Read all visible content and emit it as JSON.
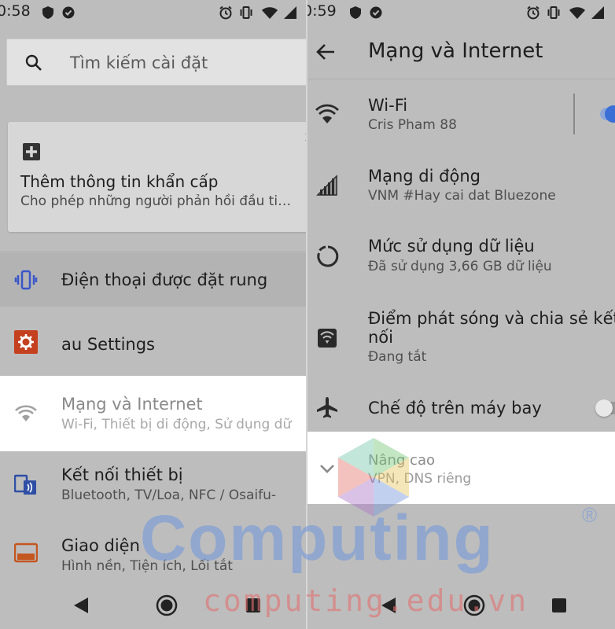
{
  "left": {
    "status_time": "0:58",
    "search_placeholder": "Tìm kiếm cài đặt",
    "card": {
      "title": "Thêm thông tin khẩn cấp",
      "subtitle": "Cho phép những người phản hồi đầu ti…"
    },
    "items": [
      {
        "title": "Điện thoại được đặt rung",
        "subtitle": ""
      },
      {
        "title": "au Settings",
        "subtitle": ""
      },
      {
        "title": "Mạng và Internet",
        "subtitle": "Wi-Fi, Thiết bị di động, Sử dụng dữ"
      },
      {
        "title": "Kết nối thiết bị",
        "subtitle": "Bluetooth, TV/Loa, NFC / Osaifu-"
      },
      {
        "title": "Giao diện",
        "subtitle": "Hình nền, Tiện ích, Lối tắt"
      }
    ]
  },
  "right": {
    "status_time": "0:59",
    "title": "Mạng và Internet",
    "items": [
      {
        "title": "Wi-Fi",
        "subtitle": "Cris Pham 88"
      },
      {
        "title": "Mạng di động",
        "subtitle": "VNM #Hay cai dat Bluezone"
      },
      {
        "title": "Mức sử dụng dữ liệu",
        "subtitle": "Đã sử dụng 3,66 GB dữ liệu"
      },
      {
        "title": "Điểm phát sóng và chia sẻ kết",
        "title2": "nối",
        "subtitle": "Đang tắt"
      },
      {
        "title": "Chế độ trên máy bay",
        "subtitle": ""
      },
      {
        "title": "Nâng cao",
        "subtitle": "VPN, DNS riêng"
      }
    ],
    "wifi_toggle_on": true,
    "airplane_toggle_on": false
  },
  "watermark": {
    "brand": "Computing",
    "url": "computing.edu.vn",
    "registered": "®"
  },
  "colors": {
    "accent_blue": "#3b6fd6",
    "settings_red": "#c4401f",
    "vibrate_blue": "#3a56c8",
    "display_orange": "#c4561f"
  }
}
